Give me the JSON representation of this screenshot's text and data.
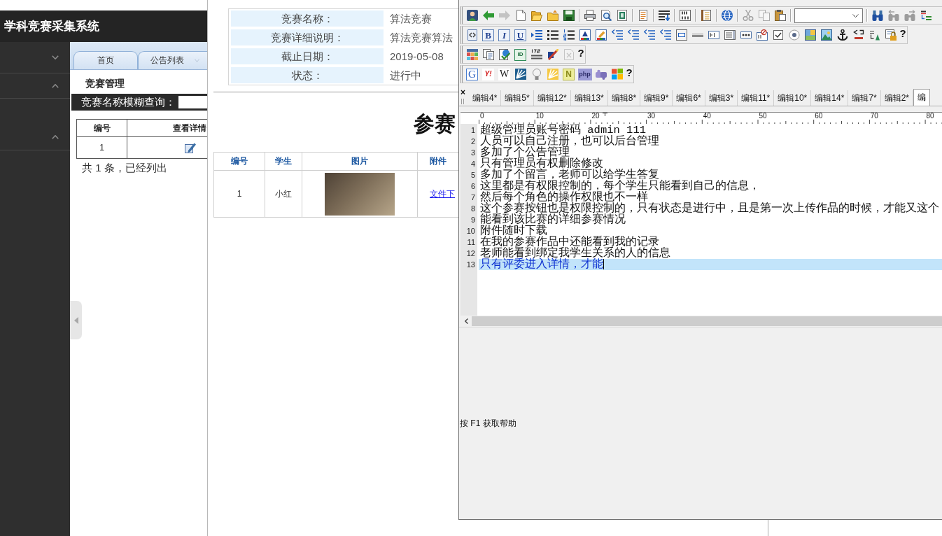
{
  "browser": {
    "header": {
      "title": "学科竞赛采集系统"
    },
    "sidebar": {
      "groups": [
        {
          "expanded": false
        },
        {
          "expanded": true
        },
        {
          "expanded": true
        }
      ]
    },
    "tabs": [
      {
        "label": "首页",
        "selected": false,
        "closable": false
      },
      {
        "label": "公告列表",
        "selected": false,
        "closable": true
      }
    ],
    "panel": {
      "title": "竞赛管理",
      "search_label": "竞赛名称模糊查询：",
      "table": {
        "columns": [
          "编号",
          "查看详情"
        ],
        "rows": [
          {
            "number": "1"
          }
        ]
      },
      "summary": "共 1 条，已经列出"
    },
    "detail": {
      "fields": [
        {
          "label": "竞赛名称：",
          "value": "算法竞赛"
        },
        {
          "label": "竞赛详细说明：",
          "value": "算法竞赛算法"
        },
        {
          "label": "截止日期：",
          "value": "2019-05-08"
        },
        {
          "label": "状态：",
          "value": "进行中"
        }
      ]
    },
    "submissions": {
      "title": "参赛",
      "columns": [
        "编号",
        "学生",
        "图片",
        "附件"
      ],
      "rows": [
        {
          "number": "1",
          "student": "小红",
          "attachment": "文件下"
        }
      ]
    }
  },
  "editor": {
    "toolbar_rows": [
      {
        "buttons": [
          {
            "disabled": false
          },
          {
            "disabled": false
          },
          {
            "disabled": true
          },
          {
            "disabled": false
          },
          {
            "disabled": false
          },
          {
            "disabled": false
          },
          {
            "disabled": false
          },
          {
            "disabled": false
          },
          {
            "disabled": false
          },
          {
            "disabled": false
          },
          {
            "disabled": false
          },
          {
            "disabled": false
          },
          {
            "disabled": false
          },
          {
            "disabled": false
          },
          {
            "disabled": false
          },
          {
            "disabled": true
          },
          {
            "disabled": true
          },
          {
            "disabled": false
          },
          {
            "disabled": false
          },
          {
            "disabled": true
          },
          {
            "disabled": true
          },
          {
            "disabled": false
          }
        ]
      },
      {
        "buttons": [
          {
            "disabled": false
          },
          {
            "label": "B",
            "disabled": false
          },
          {
            "label": "I",
            "disabled": false
          },
          {
            "label": "U",
            "disabled": false
          },
          {
            "disabled": false
          },
          {
            "disabled": false
          },
          {
            "disabled": false
          },
          {
            "disabled": false
          },
          {
            "disabled": false
          },
          {
            "disabled": false
          },
          {
            "disabled": false
          },
          {
            "disabled": false
          },
          {
            "disabled": false
          },
          {
            "disabled": false
          },
          {
            "disabled": false
          },
          {
            "disabled": false
          },
          {
            "disabled": false
          },
          {
            "disabled": false
          },
          {
            "disabled": false
          },
          {
            "disabled": false
          },
          {
            "disabled": false
          },
          {
            "disabled": false
          },
          {
            "disabled": false
          },
          {
            "disabled": false
          },
          {
            "disabled": false
          },
          {
            "disabled": false
          },
          {
            "disabled": false
          },
          {
            "label": "?",
            "disabled": false
          }
        ]
      },
      {
        "buttons": [
          {
            "disabled": false
          },
          {
            "disabled": false
          },
          {
            "disabled": false
          },
          {
            "label": "ID",
            "disabled": false
          },
          {
            "disabled": false
          },
          {
            "disabled": false
          },
          {
            "disabled": true
          },
          {
            "label": "?",
            "disabled": false
          }
        ]
      },
      {
        "buttons": [
          {
            "label": "G",
            "disabled": false
          },
          {
            "label": "Y!",
            "disabled": false
          },
          {
            "label": "W",
            "disabled": false
          },
          {
            "disabled": false
          },
          {
            "disabled": false
          },
          {
            "disabled": false
          },
          {
            "label": "N",
            "disabled": false
          },
          {
            "label": "php",
            "disabled": false
          },
          {
            "disabled": false
          },
          {
            "disabled": false
          },
          {
            "label": "?",
            "disabled": false
          }
        ]
      }
    ],
    "tab_close": "×",
    "tabs": [
      {
        "label": "编辑4*",
        "selected": false
      },
      {
        "label": "编辑5*",
        "selected": false
      },
      {
        "label": "编辑12*",
        "selected": false
      },
      {
        "label": "编辑13*",
        "selected": false
      },
      {
        "label": "编辑8*",
        "selected": false
      },
      {
        "label": "编辑9*",
        "selected": false
      },
      {
        "label": "编辑6*",
        "selected": false
      },
      {
        "label": "编辑3*",
        "selected": false
      },
      {
        "label": "编辑11*",
        "selected": false
      },
      {
        "label": "编辑10*",
        "selected": false
      },
      {
        "label": "编辑14*",
        "selected": false
      },
      {
        "label": "编辑7*",
        "selected": false
      },
      {
        "label": "编辑2*",
        "selected": false
      },
      {
        "label": "编",
        "selected": true
      }
    ],
    "ruler": [
      "0",
      "10",
      "20",
      "30",
      "40",
      "50",
      "60",
      "70",
      "80"
    ],
    "lines": [
      {
        "number": "1",
        "text": "超级管理员账号密码 admin 111",
        "selected": false
      },
      {
        "number": "2",
        "text": "人员可以自己注册，也可以后台管理",
        "selected": false
      },
      {
        "number": "3",
        "text": "多加了个公告管理",
        "selected": false
      },
      {
        "number": "4",
        "text": "只有管理员有权删除修改",
        "selected": false
      },
      {
        "number": "5",
        "text": "多加了个留言，老师可以给学生答复",
        "selected": false
      },
      {
        "number": "6",
        "text": "这里都是有权限控制的，每个学生只能看到自己的信息，",
        "selected": false
      },
      {
        "number": "7",
        "text": "然后每个角色的操作权限也不一样",
        "selected": false
      },
      {
        "number": "8",
        "text": "这个参赛按钮也是权限控制的，只有状态是进行中，且是第一次上传作品的时候，才能又这个",
        "selected": false
      },
      {
        "number": "9",
        "text": "能看到该比赛的详细参赛情况",
        "selected": false
      },
      {
        "number": "10",
        "text": "附件随时下载",
        "selected": false
      },
      {
        "number": "11",
        "text": "在我的参赛作品中还能看到我的记录",
        "selected": false
      },
      {
        "number": "12",
        "text": "老师能看到绑定我学生关系的人的信息",
        "selected": false
      },
      {
        "number": "13",
        "text": "只有评委进入详情，才能",
        "selected": true
      }
    ],
    "status": "按 F1 获取帮助"
  }
}
